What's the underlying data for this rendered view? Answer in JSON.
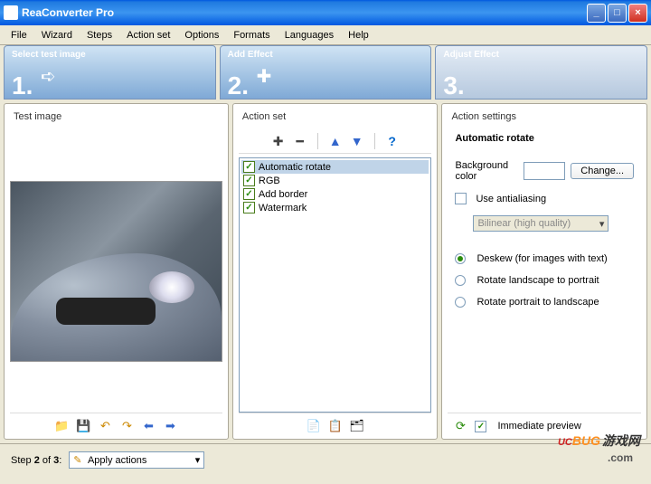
{
  "window": {
    "title": "ReaConverter Pro"
  },
  "menu": [
    "File",
    "Wizard",
    "Steps",
    "Action set",
    "Options",
    "Formats",
    "Languages",
    "Help"
  ],
  "steps": [
    {
      "label": "Select test image",
      "num": "1."
    },
    {
      "label": "Add Effect",
      "num": "2."
    },
    {
      "label": "Adjust Effect",
      "num": "3."
    }
  ],
  "leftPanel": {
    "title": "Test image"
  },
  "midPanel": {
    "title": "Action set",
    "actions": [
      {
        "label": "Automatic rotate",
        "checked": true,
        "selected": true
      },
      {
        "label": "RGB",
        "checked": true,
        "selected": false
      },
      {
        "label": "Add border",
        "checked": true,
        "selected": false
      },
      {
        "label": "Watermark",
        "checked": true,
        "selected": false
      }
    ]
  },
  "rightPanel": {
    "title": "Action settings",
    "settingTitle": "Automatic rotate",
    "bgColorLabel": "Background color",
    "changeBtn": "Change...",
    "antialias": {
      "label": "Use antialiasing",
      "checked": false
    },
    "quality": "Bilinear (high quality)",
    "radios": [
      {
        "label": "Deskew (for images with text)",
        "on": true
      },
      {
        "label": "Rotate landscape to portrait",
        "on": false
      },
      {
        "label": "Rotate portrait to landscape",
        "on": false
      }
    ],
    "immediatePreview": {
      "label": "Immediate preview",
      "checked": true
    }
  },
  "bottom": {
    "stepText": "Step 2 of 3:",
    "selectValue": "Apply actions"
  },
  "watermark": {
    "p1": "UC",
    "p2": "BUG",
    "p3": "游戏网",
    "sub": ".com"
  }
}
